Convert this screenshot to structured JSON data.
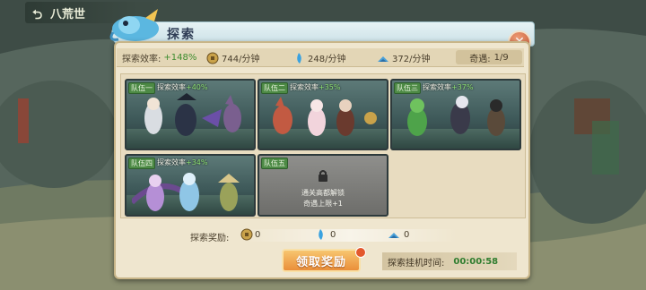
{
  "top_bar": {
    "title": "八荒世"
  },
  "panel": {
    "title": "探索"
  },
  "stats": {
    "efficiency_label": "探索效率:",
    "efficiency_value": "+148%",
    "coin_rate": "744/分钟",
    "crystal_rate": "248/分钟",
    "ore_rate": "372/分钟",
    "encounter_label": "奇遇:",
    "encounter_value": "1/9"
  },
  "teams": [
    {
      "tag": "队伍一",
      "eff_label": "探索效率",
      "eff_value": "+40%"
    },
    {
      "tag": "队伍二",
      "eff_label": "探索效率",
      "eff_value": "+35%"
    },
    {
      "tag": "队伍三",
      "eff_label": "探索效率",
      "eff_value": "+37%"
    },
    {
      "tag": "队伍四",
      "eff_label": "探索效率",
      "eff_value": "+34%"
    },
    {
      "tag": "队伍五",
      "locked_line1": "通关高都解锁",
      "locked_line2": "奇遇上限+1"
    }
  ],
  "rewards": {
    "label": "探索奖励:",
    "coin": "0",
    "crystal": "0",
    "ore": "0"
  },
  "claim_button": "领取奖励",
  "idle": {
    "label": "探索挂机时间:",
    "value": "00:00:58"
  },
  "colors": {
    "panel": "#efe6cf",
    "accent_green": "#3d8c2f",
    "button": "#ea8f3a"
  },
  "icons": [
    "back-arrow-icon",
    "coin-icon",
    "crystal-icon",
    "ore-icon",
    "close-icon",
    "lock-icon"
  ]
}
